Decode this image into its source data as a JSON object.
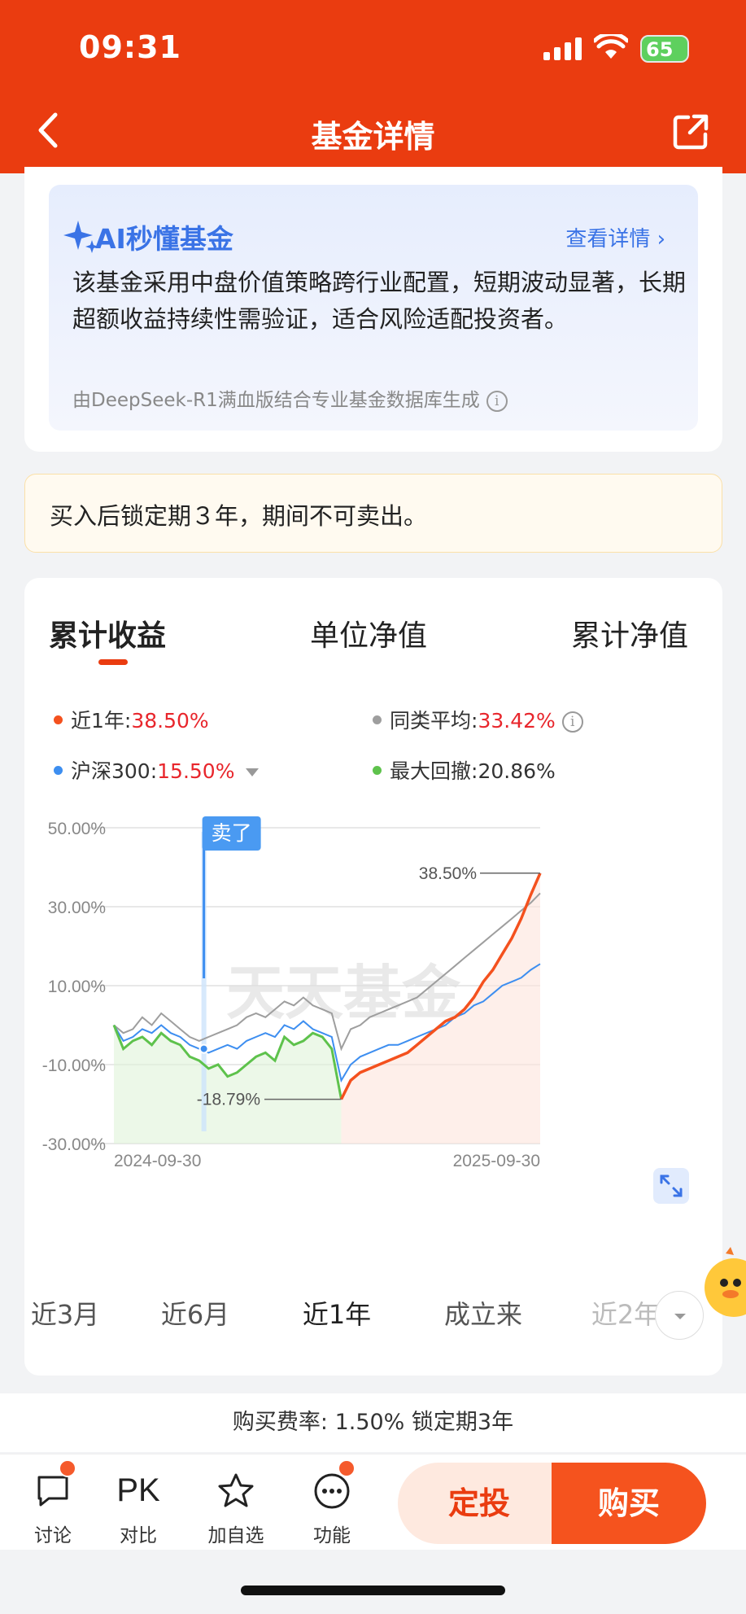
{
  "status": {
    "time": "09:31",
    "battery": "65"
  },
  "nav": {
    "title": "基金详情"
  },
  "ai": {
    "title": "AI秒懂基金",
    "more": "查看详情 ›",
    "desc": "该基金采用中盘价值策略跨行业配置，短期波动显著，长期超额收益持续性需验证，适合风险适配投资者。",
    "source": "由DeepSeek-R1满血版结合专业基金数据库生成",
    "info_icon": "i"
  },
  "lock": {
    "text": "买入后锁定期３年，期间不可卖出。"
  },
  "tabs": [
    "累计收益",
    "单位净值",
    "累计净值"
  ],
  "legend": {
    "l1_label": "近1年:",
    "l1_value": "38.50%",
    "l2_label": "同类平均:",
    "l2_value": "33.42%",
    "l3_label": "沪深300:",
    "l3_value": "15.50%",
    "l4_label": "最大回撤:",
    "l4_value": "20.86%"
  },
  "colors": {
    "fund": "#f4511e",
    "avg": "#9e9e9e",
    "index": "#3d8ef0",
    "drawdown": "#5ec24c"
  },
  "chart_data": {
    "type": "line",
    "x_start": "2024-09-30",
    "x_end": "2025-09-30",
    "y_ticks": [
      "50.00%",
      "30.00%",
      "10.00%",
      "-10.00%",
      "-30.00%"
    ],
    "ylim": [
      -30,
      50
    ],
    "watermark": "天天基金",
    "sell_marker": "卖了",
    "end_label": "38.50%",
    "min_label": "-18.79%",
    "series": [
      {
        "name": "近1年",
        "values": [
          0,
          -6,
          -4,
          -3,
          -5,
          -2,
          -4,
          -5,
          -8,
          -9,
          -11,
          -10,
          -13,
          -12,
          -10,
          -8,
          -7,
          -9,
          -3,
          -5,
          -4,
          -2,
          -3,
          -6,
          -18.79,
          -14,
          -12,
          -11,
          -10,
          -9,
          -8,
          -7,
          -5,
          -3,
          -1,
          1,
          2,
          4,
          7,
          11,
          14,
          18,
          22,
          27,
          33,
          38.5
        ]
      },
      {
        "name": "同类平均",
        "values": [
          0,
          -2,
          -1,
          2,
          0,
          3,
          1,
          -1,
          -3,
          -4,
          -3,
          -2,
          -1,
          0,
          2,
          3,
          2,
          4,
          6,
          5,
          7,
          5,
          4,
          3,
          -6,
          -1,
          0,
          2,
          3,
          4,
          5,
          6,
          7,
          9,
          11,
          13,
          15,
          17,
          19,
          21,
          23,
          25,
          27,
          29,
          31,
          33.42
        ]
      },
      {
        "name": "沪深300",
        "values": [
          0,
          -4,
          -3,
          -1,
          -2,
          0,
          -2,
          -3,
          -5,
          -6,
          -7,
          -6,
          -5,
          -6,
          -4,
          -3,
          -2,
          -3,
          0,
          -1,
          1,
          -1,
          -2,
          -3,
          -14,
          -10,
          -8,
          -7,
          -6,
          -5,
          -5,
          -4,
          -3,
          -2,
          -1,
          0,
          2,
          3,
          5,
          6,
          8,
          10,
          11,
          12,
          14,
          15.5
        ]
      },
      {
        "name": "最大回撤",
        "values": [
          0,
          -6,
          -4,
          -3,
          -5,
          -2,
          -4,
          -5,
          -8,
          -9,
          -11,
          -10,
          -13,
          -12,
          -10,
          -8,
          -7,
          -9,
          -3,
          -5,
          -4,
          -2,
          -3,
          -6,
          -18.79
        ]
      }
    ]
  },
  "ranges": [
    "近3月",
    "近6月",
    "近1年",
    "成立来",
    "近2年"
  ],
  "fee": {
    "text": "购买费率: 1.50%  锁定期3年"
  },
  "tools": {
    "discuss": "讨论",
    "pk_icon": "PK",
    "pk": "对比",
    "fav": "加自选",
    "func": "功能"
  },
  "buttons": {
    "plan": "定投",
    "buy": "购买"
  }
}
